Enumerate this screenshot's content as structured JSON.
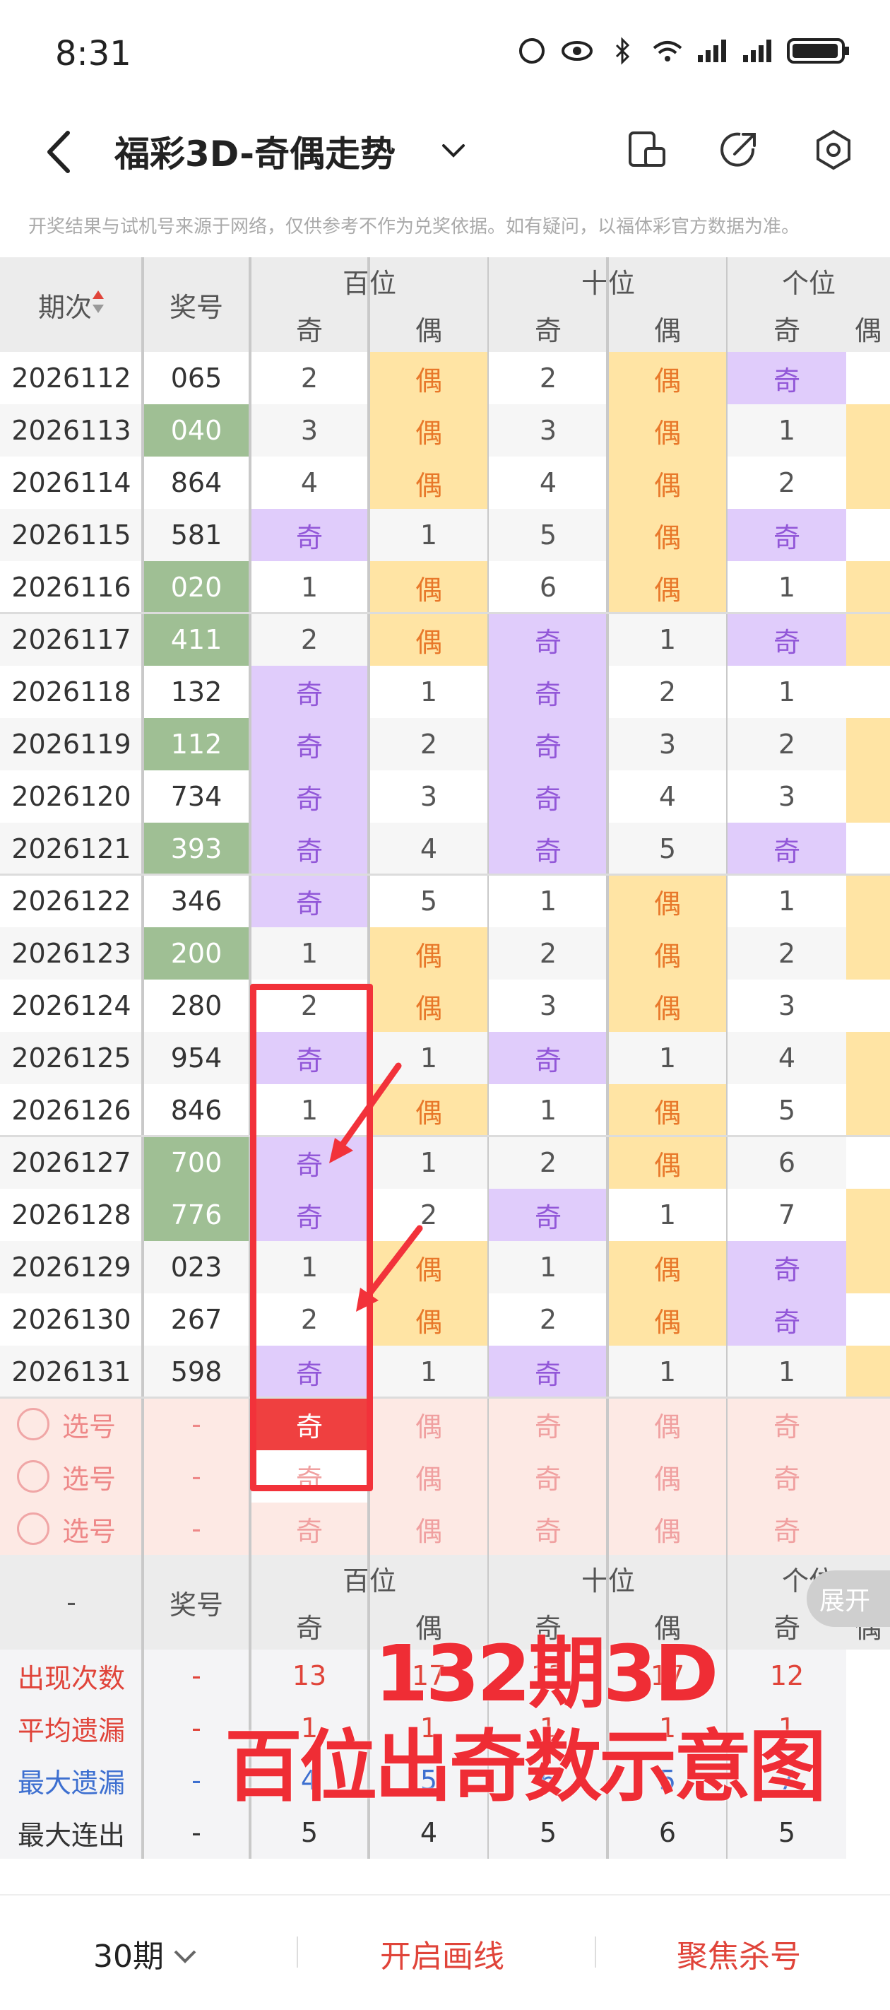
{
  "status": {
    "time": "8:31"
  },
  "header": {
    "title": "福彩3D-奇偶走势"
  },
  "notice": "开奖结果与试机号来源于网络，仅供参考不作为兑奖依据。如有疑问，以福体彩官方数据为准。",
  "table": {
    "col_period": "期次",
    "col_number": "奖号",
    "groups": [
      "百位",
      "十位",
      "个位"
    ],
    "odd": "奇",
    "even": "偶",
    "rows": [
      {
        "p": "2026112",
        "n": "065",
        "hl": false,
        "c": [
          "2",
          "偶",
          "2",
          "偶",
          "奇"
        ]
      },
      {
        "p": "2026113",
        "n": "040",
        "hl": true,
        "c": [
          "3",
          "偶",
          "3",
          "偶",
          "1"
        ]
      },
      {
        "p": "2026114",
        "n": "864",
        "hl": false,
        "c": [
          "4",
          "偶",
          "4",
          "偶",
          "2"
        ]
      },
      {
        "p": "2026115",
        "n": "581",
        "hl": false,
        "c": [
          "奇",
          "1",
          "5",
          "偶",
          "奇"
        ]
      },
      {
        "p": "2026116",
        "n": "020",
        "hl": true,
        "c": [
          "1",
          "偶",
          "6",
          "偶",
          "1"
        ]
      },
      {
        "p": "2026117",
        "n": "411",
        "hl": true,
        "c": [
          "2",
          "偶",
          "奇",
          "1",
          "奇"
        ]
      },
      {
        "p": "2026118",
        "n": "132",
        "hl": false,
        "c": [
          "奇",
          "1",
          "奇",
          "2",
          "1"
        ]
      },
      {
        "p": "2026119",
        "n": "112",
        "hl": true,
        "c": [
          "奇",
          "2",
          "奇",
          "3",
          "2"
        ]
      },
      {
        "p": "2026120",
        "n": "734",
        "hl": false,
        "c": [
          "奇",
          "3",
          "奇",
          "4",
          "3"
        ]
      },
      {
        "p": "2026121",
        "n": "393",
        "hl": true,
        "c": [
          "奇",
          "4",
          "奇",
          "5",
          "奇"
        ]
      },
      {
        "p": "2026122",
        "n": "346",
        "hl": false,
        "c": [
          "奇",
          "5",
          "1",
          "偶",
          "1"
        ]
      },
      {
        "p": "2026123",
        "n": "200",
        "hl": true,
        "c": [
          "1",
          "偶",
          "2",
          "偶",
          "2"
        ]
      },
      {
        "p": "2026124",
        "n": "280",
        "hl": false,
        "c": [
          "2",
          "偶",
          "3",
          "偶",
          "3"
        ]
      },
      {
        "p": "2026125",
        "n": "954",
        "hl": false,
        "c": [
          "奇",
          "1",
          "奇",
          "1",
          "4"
        ]
      },
      {
        "p": "2026126",
        "n": "846",
        "hl": false,
        "c": [
          "1",
          "偶",
          "1",
          "偶",
          "5"
        ]
      },
      {
        "p": "2026127",
        "n": "700",
        "hl": true,
        "c": [
          "奇",
          "1",
          "2",
          "偶",
          "6"
        ]
      },
      {
        "p": "2026128",
        "n": "776",
        "hl": true,
        "c": [
          "奇",
          "2",
          "奇",
          "1",
          "7"
        ]
      },
      {
        "p": "2026129",
        "n": "023",
        "hl": false,
        "c": [
          "1",
          "偶",
          "1",
          "偶",
          "奇"
        ]
      },
      {
        "p": "2026130",
        "n": "267",
        "hl": false,
        "c": [
          "2",
          "偶",
          "2",
          "偶",
          "奇"
        ]
      },
      {
        "p": "2026131",
        "n": "598",
        "hl": false,
        "c": [
          "奇",
          "1",
          "奇",
          "1",
          "1"
        ]
      }
    ],
    "pick_label": "选号",
    "pick_dash": "-",
    "pick_cells": [
      "奇",
      "偶",
      "奇",
      "偶",
      "奇"
    ],
    "footer_dash": "-",
    "stats": [
      {
        "label": "出现次数",
        "color": "#e0443a",
        "v": [
          "13",
          "17",
          "13",
          "17",
          "12"
        ]
      },
      {
        "label": "平均遗漏",
        "color": "#e0443a",
        "v": [
          "1",
          "1",
          "1",
          "1",
          "1"
        ]
      },
      {
        "label": "最大遗漏",
        "color": "#3d6fd0",
        "v": [
          "4",
          "5",
          "6",
          "5",
          "7"
        ]
      },
      {
        "label": "最大连出",
        "color": "#333",
        "v": [
          "5",
          "4",
          "5",
          "6",
          "5"
        ]
      }
    ],
    "stat_dash": "-",
    "expand": "展开"
  },
  "overlay": {
    "line1": "132期3D",
    "line2": "百位出奇数示意图"
  },
  "bottom": {
    "periods": "30期",
    "draw_line": "开启画线",
    "focus_kill": "聚焦杀号"
  },
  "colors": {
    "odd_bg": "#e0ccfb",
    "even_bg": "#ffe4a4",
    "num_hl": "#9fbf94",
    "accent": "#ef2d35",
    "odd_text": "#9257d8",
    "even_text": "#e8782a",
    "pick_bg": "#fde9e4"
  }
}
